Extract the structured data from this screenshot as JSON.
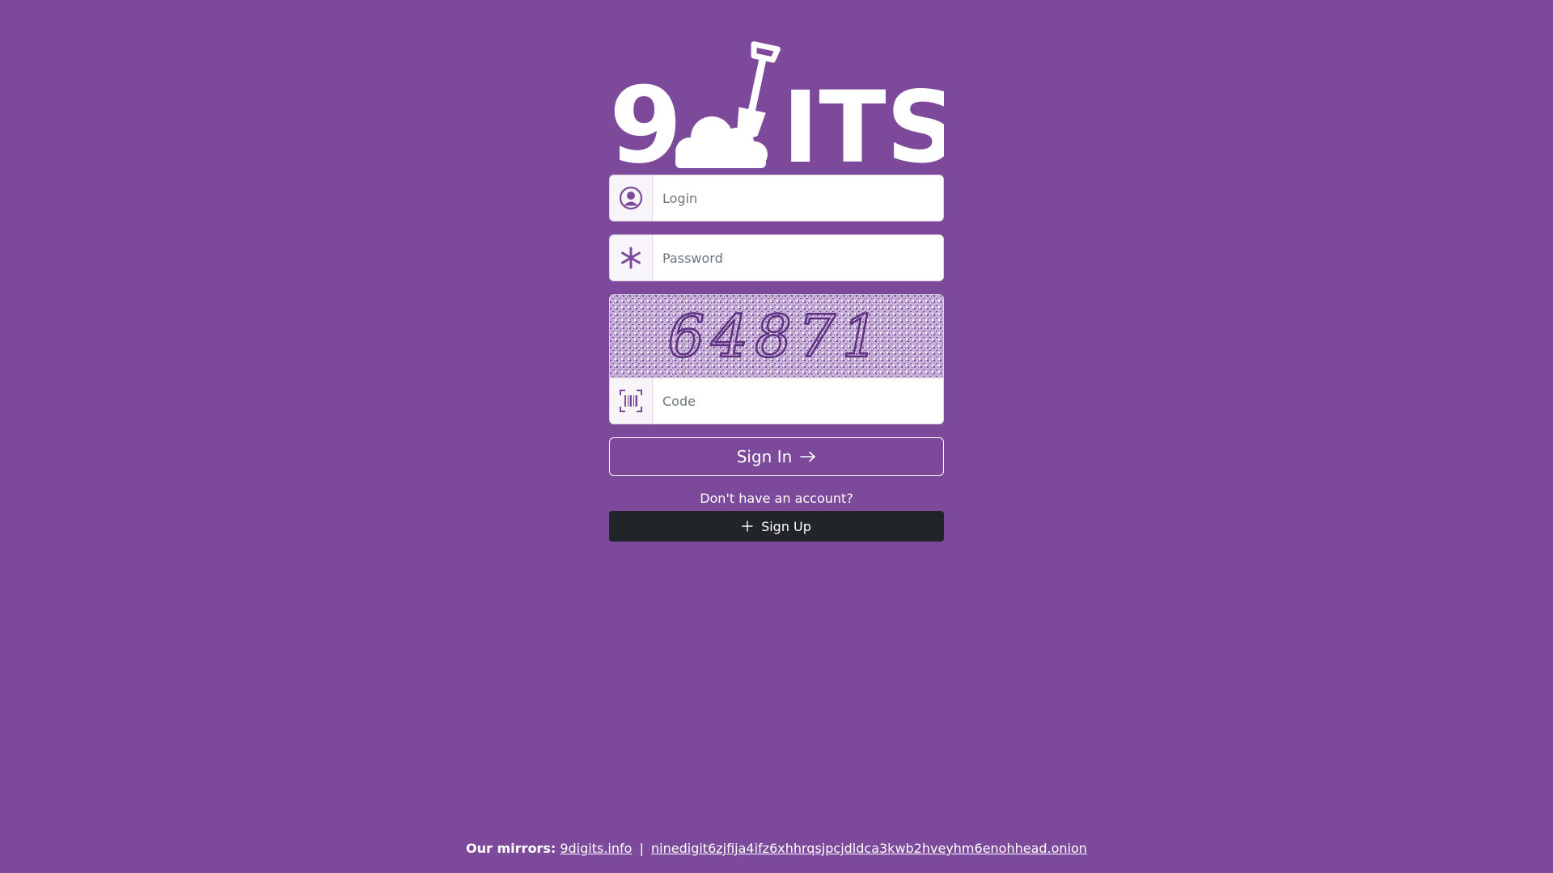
{
  "logo": {
    "text_left": "9",
    "text_right": "ITS",
    "brand_color": "#ffffff"
  },
  "form": {
    "login": {
      "placeholder": "Login",
      "icon": "user-circle-icon"
    },
    "password": {
      "placeholder": "Password",
      "icon": "asterisk-icon"
    },
    "captcha": {
      "image_text": "64871",
      "placeholder": "Code",
      "icon": "barcode-scan-icon"
    },
    "signin_label": "Sign In",
    "no_account_text": "Don't have an account?",
    "signup_label": "Sign Up"
  },
  "footer": {
    "label": "Our mirrors:",
    "mirror_1": "9digits.info",
    "separator": "|",
    "mirror_2": "ninedigit6zjfija4ifz6xhhrqsjpcjdldca3kwb2hveyhm6enohhead.onion"
  },
  "colors": {
    "background": "#7d4a9b",
    "accent": "#7d4a9b",
    "dark_button": "#212529"
  }
}
